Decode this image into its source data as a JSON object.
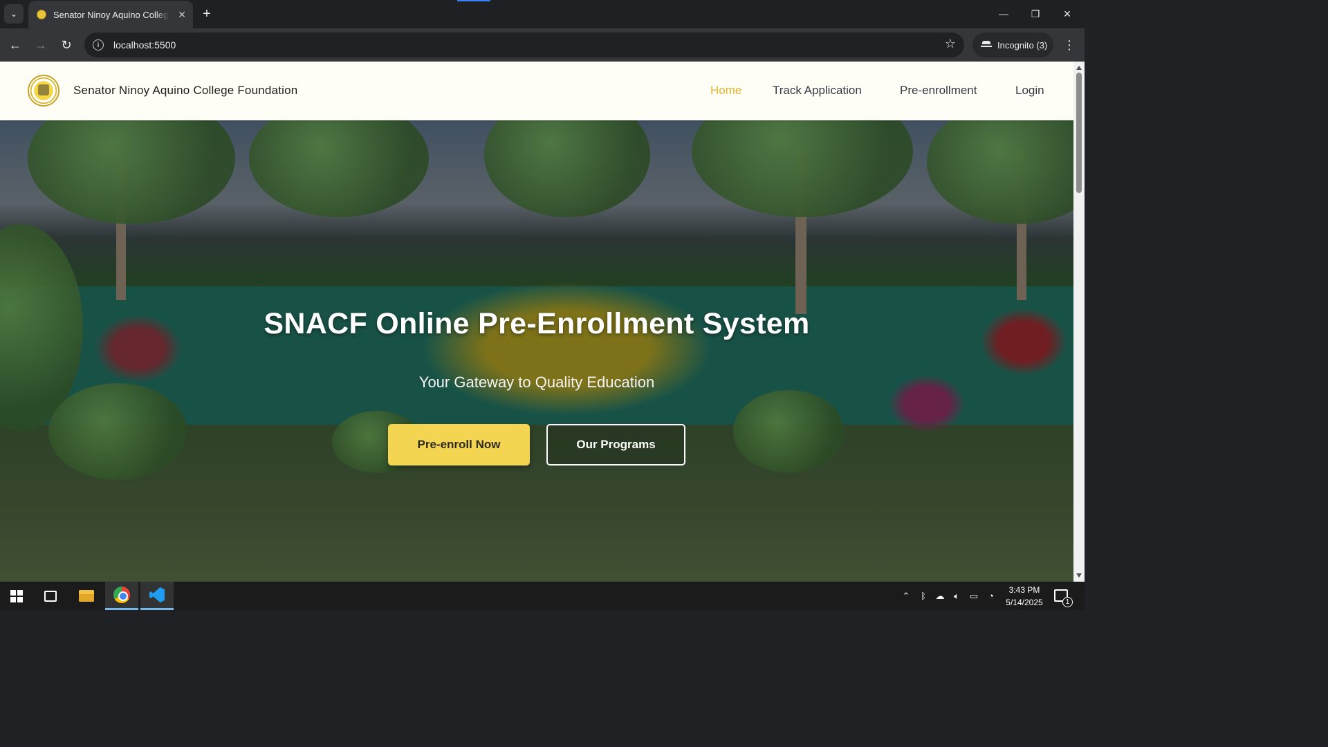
{
  "browser": {
    "tab": {
      "title": "Senator Ninoy Aquino College Foundation",
      "favicon": "snacf-logo-icon"
    },
    "url": "localhost:5500",
    "incognito_label": "Incognito (3)",
    "icons": {
      "tab_search": "chevron-down-icon",
      "close_tab": "close-icon",
      "new_tab": "plus-icon",
      "back": "arrow-left-icon",
      "forward": "arrow-right-icon",
      "reload": "reload-icon",
      "site_info": "info-icon",
      "bookmark": "star-icon",
      "menu": "kebab-menu-icon"
    }
  },
  "site": {
    "brand": "Senator Ninoy Aquino College Foundation",
    "nav": [
      {
        "label": "Home",
        "active": true
      },
      {
        "label": "Track Application",
        "active": false
      },
      {
        "label": "Pre-enrollment",
        "active": false
      },
      {
        "label": "Login",
        "active": false
      }
    ],
    "hero": {
      "title": "SNACF Online Pre-Enrollment System",
      "subtitle": "Your Gateway to Quality Education",
      "primary_button": "Pre-enroll Now",
      "secondary_button": "Our Programs"
    },
    "colors": {
      "accent": "#e2b42d",
      "primary_button": "#f4d551",
      "nav_background": "#fffef6"
    }
  },
  "taskbar": {
    "apps": [
      "windows-start-icon",
      "task-view-icon",
      "file-explorer-icon",
      "chrome-icon",
      "vscode-icon"
    ],
    "tray_icons": [
      "chevron-up-icon",
      "bluetooth-icon",
      "onedrive-cloud-icon",
      "volume-icon",
      "battery-icon",
      "wifi-icon"
    ],
    "time": "3:43 PM",
    "date": "5/14/2025",
    "notification_count": "1"
  }
}
